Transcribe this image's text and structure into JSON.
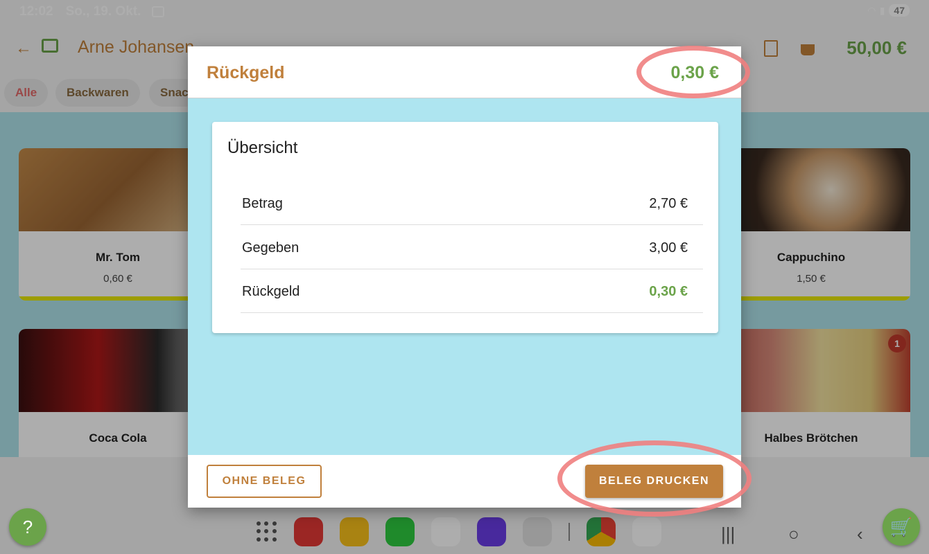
{
  "status_bar": {
    "time": "12:02",
    "date": "So., 19. Okt.",
    "battery": "47"
  },
  "header": {
    "customer_name": "Arne Johansen",
    "total": "50,00 €",
    "icons": [
      "back-arrow-icon",
      "cash-register-icon",
      "receipt-icon",
      "basket-icon"
    ]
  },
  "categories": [
    {
      "label": "Alle",
      "active": true
    },
    {
      "label": "Backwaren",
      "active": false
    },
    {
      "label": "Snac",
      "active": false
    }
  ],
  "products": [
    {
      "name": "Mr. Tom",
      "price": "0,60 €"
    },
    {
      "name": "Cappuchino",
      "price": "1,50 €"
    },
    {
      "name": "Coca Cola",
      "price": "",
      "partial_price": true
    },
    {
      "name": "Halbes Brötchen",
      "price": "",
      "badge": "1"
    }
  ],
  "dialog": {
    "title": "Rückgeld",
    "header_amount": "0,30 €",
    "panel_title": "Übersicht",
    "rows": [
      {
        "label": "Betrag",
        "value": "2,70 €"
      },
      {
        "label": "Gegeben",
        "value": "3,00 €"
      },
      {
        "label": "Rückgeld",
        "value": "0,30 €"
      }
    ],
    "button_secondary": "OHNE BELEG",
    "button_primary": "BELEG DRUCKEN"
  },
  "fabs": {
    "help_label": "?",
    "cart_icon": "cart-icon"
  },
  "colors": {
    "accent_brown": "#c0803c",
    "accent_green": "#6ba34a",
    "dialog_bg": "#aee5f0",
    "highlight": "#f08080"
  }
}
